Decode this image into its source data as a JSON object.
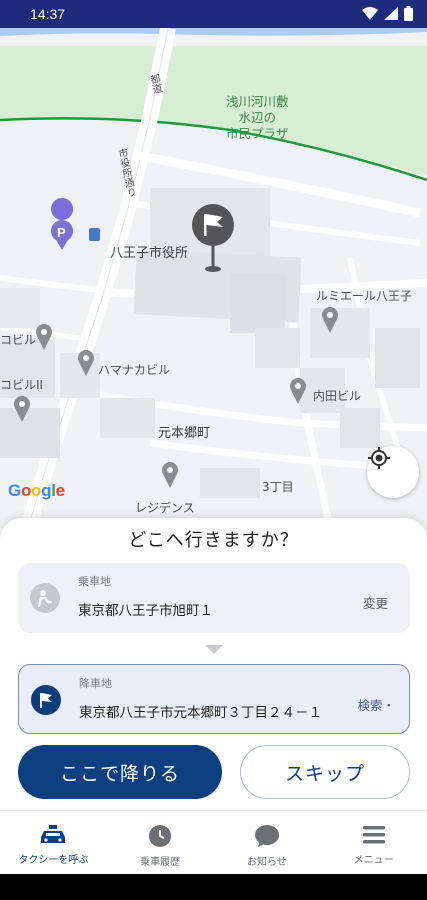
{
  "status_bar": {
    "time": "14:37"
  },
  "map": {
    "labels": {
      "park": [
        "浅川河川敷",
        "水辺の",
        "市民プラザ"
      ],
      "city_hall": "八王子市役所",
      "street_city_hall": "市役所通り",
      "street_top": "都道",
      "lumiere": "ルミエール八王子",
      "hamanaka": "ハマナカビル",
      "uchida": "内田ビル",
      "motohongo": "元本郷町",
      "sanchome": "3丁目",
      "residence": "レジデンス",
      "bldg1": "コビル",
      "bldg2": "コビルII"
    },
    "google": [
      "G",
      "o",
      "o",
      "g",
      "l",
      "e"
    ]
  },
  "sheet": {
    "title": "どこへ行きますか？",
    "pickup": {
      "type": "乗車地",
      "address": "東京都八王子市旭町１",
      "action": "変更"
    },
    "dropoff": {
      "type": "降車地",
      "address": "東京都八王子市元本郷町３丁目２４－１",
      "action": "検索・"
    },
    "primary_button": "ここで降りる",
    "secondary_button": "スキップ"
  },
  "nav": {
    "items": [
      {
        "label": "タクシーを呼ぶ",
        "icon": "taxi-icon",
        "active": true
      },
      {
        "label": "乗車履歴",
        "icon": "clock-icon",
        "active": false
      },
      {
        "label": "お知らせ",
        "icon": "chat-bubble-icon",
        "active": false
      },
      {
        "label": "メニュー",
        "icon": "menu-icon",
        "active": false
      }
    ]
  },
  "colors": {
    "status_bar": "#1e2a7a",
    "primary": "#0b3f80",
    "park_green": "#d6ecd3",
    "boundary_green": "#1f9a3a"
  }
}
